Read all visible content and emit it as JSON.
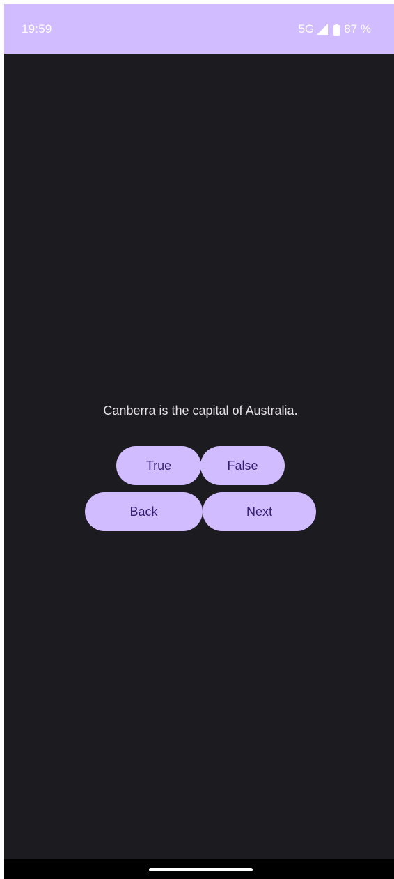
{
  "status_bar": {
    "time": "19:59",
    "network": "5G",
    "battery": "87 %",
    "icons": [
      "signal-icon",
      "battery-icon"
    ],
    "background_color": "#d0bcfe"
  },
  "quiz": {
    "question": "Canberra is the capital of Australia.",
    "true_label": "True",
    "false_label": "False",
    "back_label": "Back",
    "next_label": "Next"
  },
  "colors": {
    "background": "#1c1b20",
    "button": "#d0bcfe",
    "button_text": "#381e72",
    "question_text": "#e6e1e6"
  }
}
